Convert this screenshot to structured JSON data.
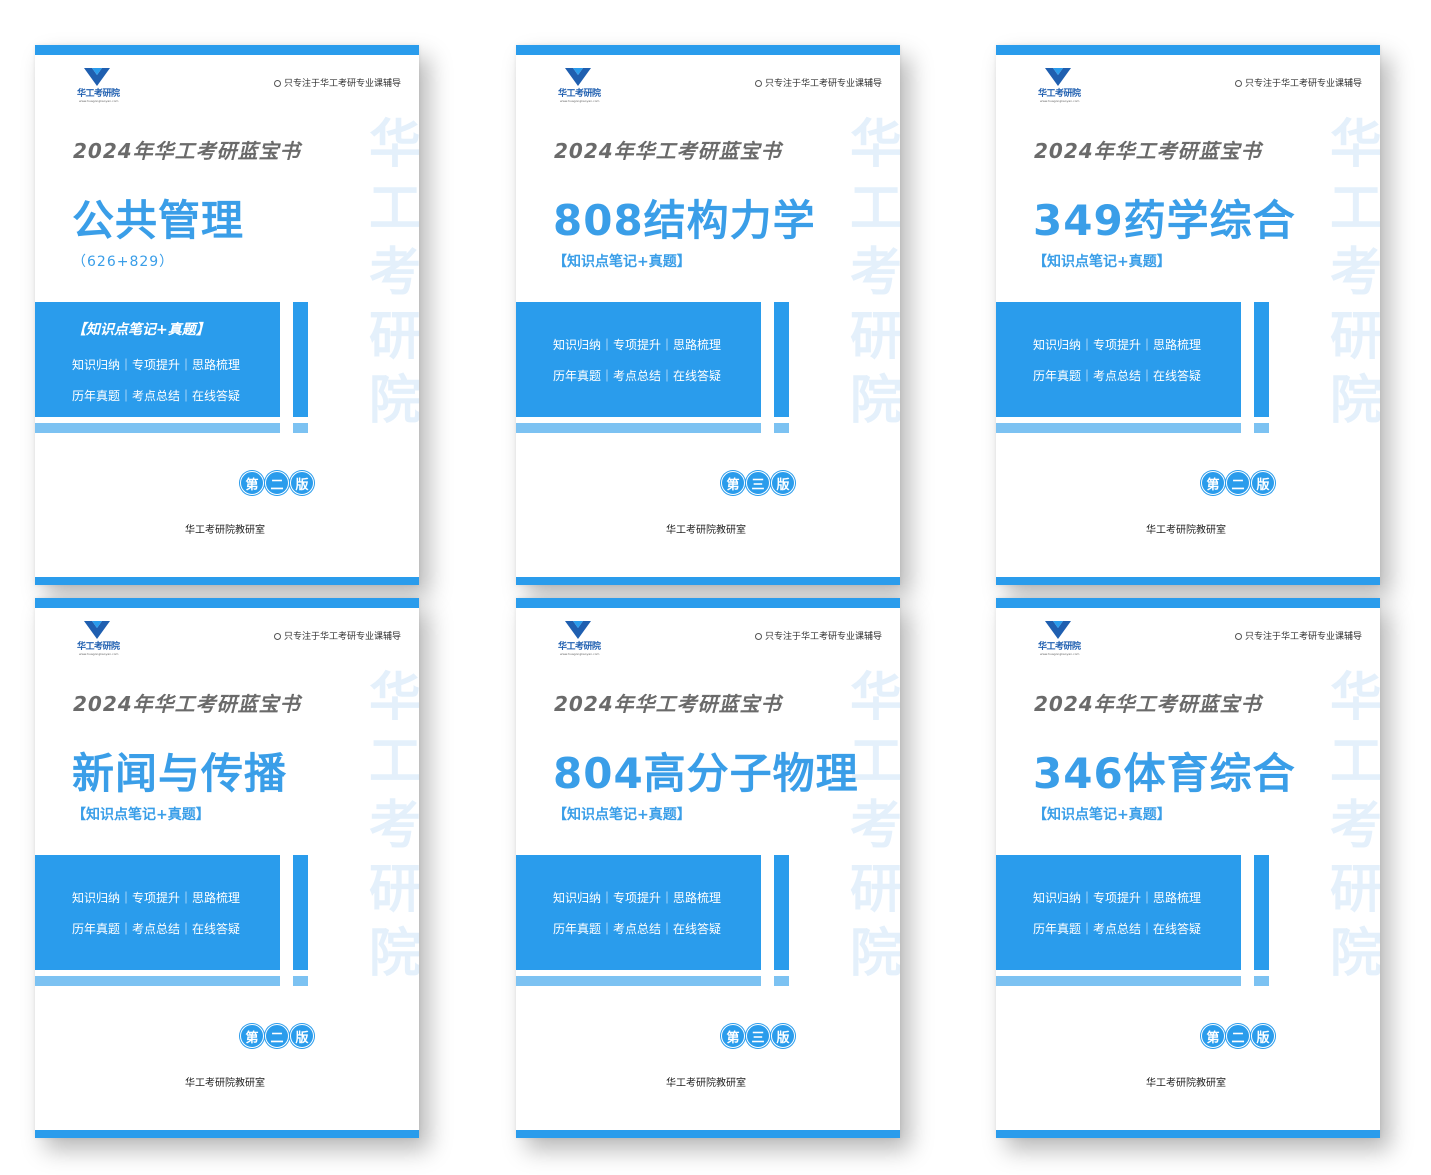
{
  "colors": {
    "accent": "#2a9cec",
    "title_gray": "#6a6a6a",
    "watermark": "#e4f0fb"
  },
  "books": [
    {
      "logo_text": "华工考研院",
      "logo_url": "www.huagongkaoyan.com",
      "slogan": "只专注于华工考研专业课辅导",
      "year_title": "2024年华工考研蓝宝书",
      "subject": "公共管理",
      "code": "（626+829）",
      "tag": "",
      "panel_tag": "【知识点笔记+真题】",
      "line1": "知识归纳｜专项提升｜思路梳理",
      "line2": "历年真题｜考点总结｜在线答疑",
      "edition": [
        "第",
        "二",
        "版"
      ],
      "publisher": "华工考研院教研室",
      "watermark": [
        "华",
        "工",
        "考",
        "研",
        "院"
      ]
    },
    {
      "logo_text": "华工考研院",
      "logo_url": "www.huagongkaoyan.com",
      "slogan": "只专注于华工考研专业课辅导",
      "year_title": "2024年华工考研蓝宝书",
      "subject": "808结构力学",
      "code": "",
      "tag": "【知识点笔记+真题】",
      "panel_tag": "",
      "line1": "知识归纳｜专项提升｜思路梳理",
      "line2": "历年真题｜考点总结｜在线答疑",
      "edition": [
        "第",
        "三",
        "版"
      ],
      "publisher": "华工考研院教研室",
      "watermark": [
        "华",
        "工",
        "考",
        "研",
        "院"
      ]
    },
    {
      "logo_text": "华工考研院",
      "logo_url": "www.huagongkaoyan.com",
      "slogan": "只专注于华工考研专业课辅导",
      "year_title": "2024年华工考研蓝宝书",
      "subject": "349药学综合",
      "code": "",
      "tag": "【知识点笔记+真题】",
      "panel_tag": "",
      "line1": "知识归纳｜专项提升｜思路梳理",
      "line2": "历年真题｜考点总结｜在线答疑",
      "edition": [
        "第",
        "二",
        "版"
      ],
      "publisher": "华工考研院教研室",
      "watermark": [
        "华",
        "工",
        "考",
        "研",
        "院"
      ]
    },
    {
      "logo_text": "华工考研院",
      "logo_url": "www.huagongkaoyan.com",
      "slogan": "只专注于华工考研专业课辅导",
      "year_title": "2024年华工考研蓝宝书",
      "subject": "新闻与传播",
      "code": "",
      "tag": "【知识点笔记+真题】",
      "panel_tag": "",
      "line1": "知识归纳｜专项提升｜思路梳理",
      "line2": "历年真题｜考点总结｜在线答疑",
      "edition": [
        "第",
        "二",
        "版"
      ],
      "publisher": "华工考研院教研室",
      "watermark": [
        "华",
        "工",
        "考",
        "研",
        "院"
      ]
    },
    {
      "logo_text": "华工考研院",
      "logo_url": "www.huagongkaoyan.com",
      "slogan": "只专注于华工考研专业课辅导",
      "year_title": "2024年华工考研蓝宝书",
      "subject": "804高分子物理",
      "code": "",
      "tag": "【知识点笔记+真题】",
      "panel_tag": "",
      "line1": "知识归纳｜专项提升｜思路梳理",
      "line2": "历年真题｜考点总结｜在线答疑",
      "edition": [
        "第",
        "三",
        "版"
      ],
      "publisher": "华工考研院教研室",
      "watermark": [
        "华",
        "工",
        "考",
        "研",
        "院"
      ]
    },
    {
      "logo_text": "华工考研院",
      "logo_url": "www.huagongkaoyan.com",
      "slogan": "只专注于华工考研专业课辅导",
      "year_title": "2024年华工考研蓝宝书",
      "subject": "346体育综合",
      "code": "",
      "tag": "【知识点笔记+真题】",
      "panel_tag": "",
      "line1": "知识归纳｜专项提升｜思路梳理",
      "line2": "历年真题｜考点总结｜在线答疑",
      "edition": [
        "第",
        "二",
        "版"
      ],
      "publisher": "华工考研院教研室",
      "watermark": [
        "华",
        "工",
        "考",
        "研",
        "院"
      ]
    }
  ]
}
